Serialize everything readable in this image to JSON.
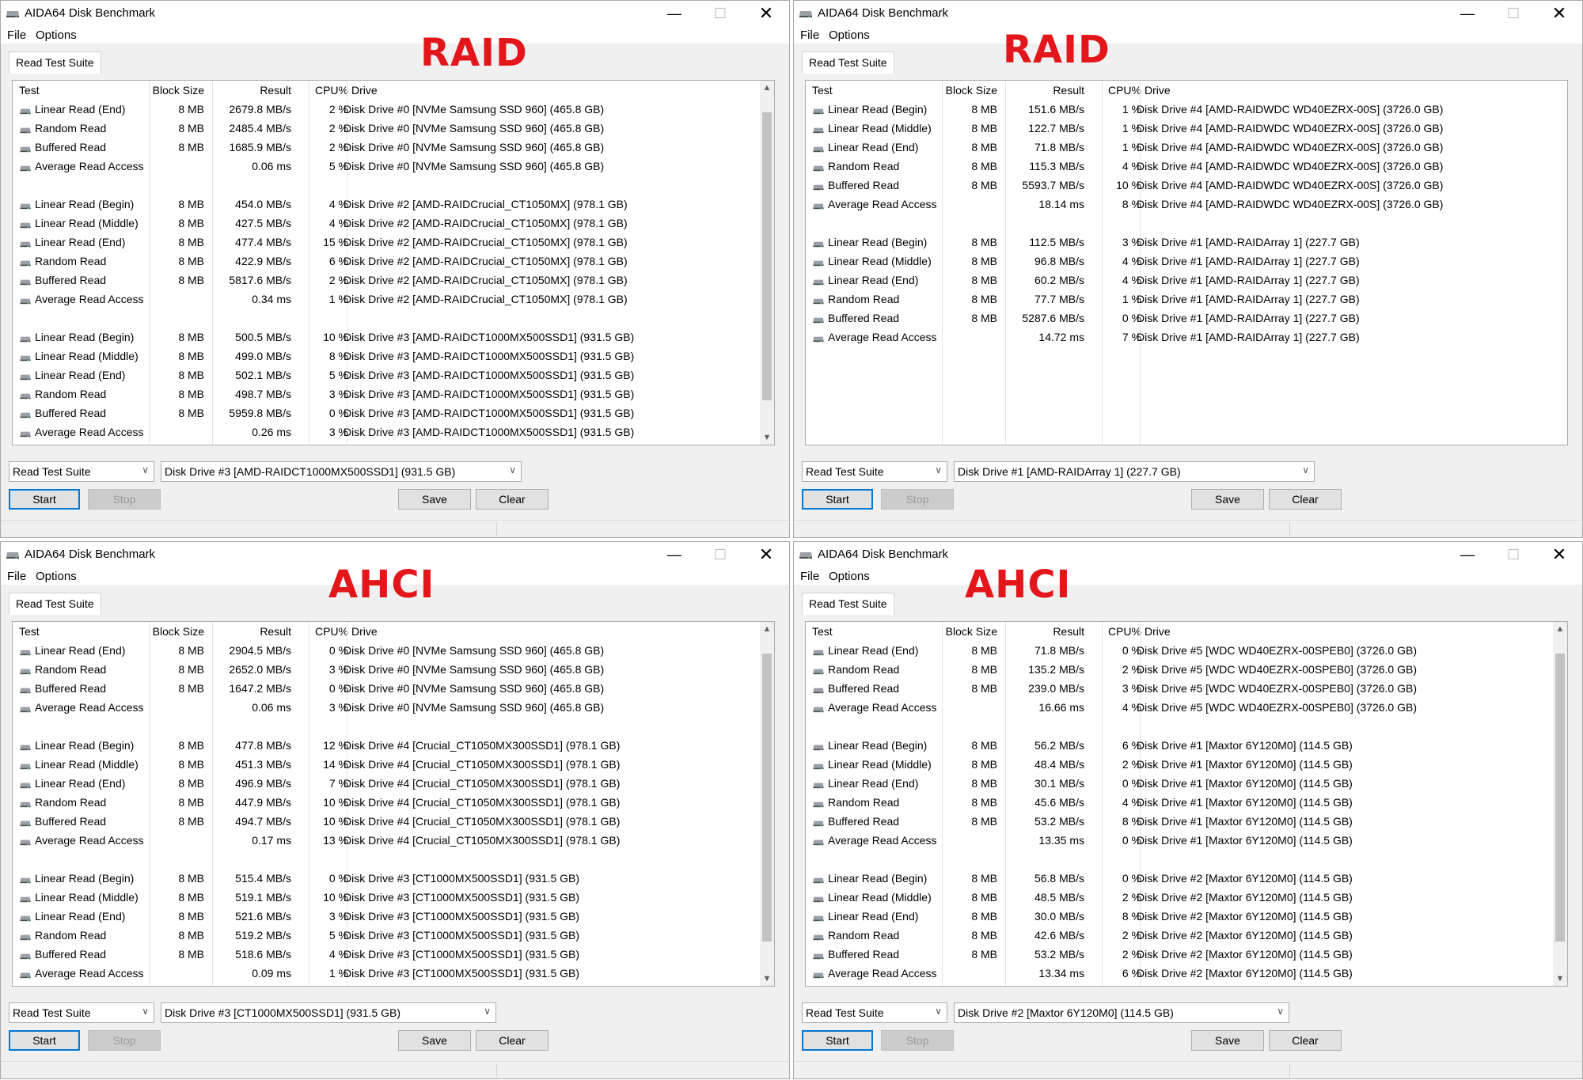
{
  "windows": [
    {
      "title": "AIDA64 Disk Benchmark",
      "menu": [
        "File",
        "Options"
      ],
      "annotation": "RAID",
      "tab": "Read Test Suite",
      "columns": [
        "Test",
        "Block Size",
        "Result",
        "CPU%",
        "Drive"
      ],
      "rows": [
        [
          "Linear Read (End)",
          "8 MB",
          "2679.8 MB/s",
          "2 %",
          "Disk Drive #0  [NVMe    Samsung SSD 960]  (465.8 GB)"
        ],
        [
          "Random Read",
          "8 MB",
          "2485.4 MB/s",
          "2 %",
          "Disk Drive #0  [NVMe    Samsung SSD 960]  (465.8 GB)"
        ],
        [
          "Buffered Read",
          "8 MB",
          "1685.9 MB/s",
          "2 %",
          "Disk Drive #0  [NVMe    Samsung SSD 960]  (465.8 GB)"
        ],
        [
          "Average Read Access",
          "",
          "0.06 ms",
          "5 %",
          "Disk Drive #0  [NVMe    Samsung SSD 960]  (465.8 GB)"
        ],
        null,
        [
          "Linear Read (Begin)",
          "8 MB",
          "454.0 MB/s",
          "4 %",
          "Disk Drive #2  [AMD-RAIDCrucial_CT1050MX]  (978.1 GB)"
        ],
        [
          "Linear Read (Middle)",
          "8 MB",
          "427.5 MB/s",
          "4 %",
          "Disk Drive #2  [AMD-RAIDCrucial_CT1050MX]  (978.1 GB)"
        ],
        [
          "Linear Read (End)",
          "8 MB",
          "477.4 MB/s",
          "15 %",
          "Disk Drive #2  [AMD-RAIDCrucial_CT1050MX]  (978.1 GB)"
        ],
        [
          "Random Read",
          "8 MB",
          "422.9 MB/s",
          "6 %",
          "Disk Drive #2  [AMD-RAIDCrucial_CT1050MX]  (978.1 GB)"
        ],
        [
          "Buffered Read",
          "8 MB",
          "5817.6 MB/s",
          "2 %",
          "Disk Drive #2  [AMD-RAIDCrucial_CT1050MX]  (978.1 GB)"
        ],
        [
          "Average Read Access",
          "",
          "0.34 ms",
          "1 %",
          "Disk Drive #2  [AMD-RAIDCrucial_CT1050MX]  (978.1 GB)"
        ],
        null,
        [
          "Linear Read (Begin)",
          "8 MB",
          "500.5 MB/s",
          "10 %",
          "Disk Drive #3  [AMD-RAIDCT1000MX500SSD1]  (931.5 GB)"
        ],
        [
          "Linear Read (Middle)",
          "8 MB",
          "499.0 MB/s",
          "8 %",
          "Disk Drive #3  [AMD-RAIDCT1000MX500SSD1]  (931.5 GB)"
        ],
        [
          "Linear Read (End)",
          "8 MB",
          "502.1 MB/s",
          "5 %",
          "Disk Drive #3  [AMD-RAIDCT1000MX500SSD1]  (931.5 GB)"
        ],
        [
          "Random Read",
          "8 MB",
          "498.7 MB/s",
          "3 %",
          "Disk Drive #3  [AMD-RAIDCT1000MX500SSD1]  (931.5 GB)"
        ],
        [
          "Buffered Read",
          "8 MB",
          "5959.8 MB/s",
          "0 %",
          "Disk Drive #3  [AMD-RAIDCT1000MX500SSD1]  (931.5 GB)"
        ],
        [
          "Average Read Access",
          "",
          "0.26 ms",
          "3 %",
          "Disk Drive #3  [AMD-RAIDCT1000MX500SSD1]  (931.5 GB)"
        ]
      ],
      "has_scrollbar": true,
      "suite_select": "Read Test Suite",
      "drive_select": "Disk Drive #3  [AMD-RAIDCT1000MX500SSD1]  (931.5 GB)",
      "buttons": {
        "start": "Start",
        "stop": "Stop",
        "save": "Save",
        "clear": "Clear"
      }
    },
    {
      "title": "AIDA64 Disk Benchmark",
      "menu": [
        "File",
        "Options"
      ],
      "annotation": "RAID",
      "tab": "Read Test Suite",
      "columns": [
        "Test",
        "Block Size",
        "Result",
        "CPU%",
        "Drive"
      ],
      "rows": [
        [
          "Linear Read (Begin)",
          "8 MB",
          "151.6 MB/s",
          "1 %",
          "Disk Drive #4  [AMD-RAIDWDC WD40EZRX-00S]  (3726.0 GB)"
        ],
        [
          "Linear Read (Middle)",
          "8 MB",
          "122.7 MB/s",
          "1 %",
          "Disk Drive #4  [AMD-RAIDWDC WD40EZRX-00S]  (3726.0 GB)"
        ],
        [
          "Linear Read (End)",
          "8 MB",
          "71.8 MB/s",
          "1 %",
          "Disk Drive #4  [AMD-RAIDWDC WD40EZRX-00S]  (3726.0 GB)"
        ],
        [
          "Random Read",
          "8 MB",
          "115.3 MB/s",
          "4 %",
          "Disk Drive #4  [AMD-RAIDWDC WD40EZRX-00S]  (3726.0 GB)"
        ],
        [
          "Buffered Read",
          "8 MB",
          "5593.7 MB/s",
          "10 %",
          "Disk Drive #4  [AMD-RAIDWDC WD40EZRX-00S]  (3726.0 GB)"
        ],
        [
          "Average Read Access",
          "",
          "18.14 ms",
          "8 %",
          "Disk Drive #4  [AMD-RAIDWDC WD40EZRX-00S]  (3726.0 GB)"
        ],
        null,
        [
          "Linear Read (Begin)",
          "8 MB",
          "112.5 MB/s",
          "3 %",
          "Disk Drive #1  [AMD-RAIDArray 1]  (227.7 GB)"
        ],
        [
          "Linear Read (Middle)",
          "8 MB",
          "96.8 MB/s",
          "4 %",
          "Disk Drive #1  [AMD-RAIDArray 1]  (227.7 GB)"
        ],
        [
          "Linear Read (End)",
          "8 MB",
          "60.2 MB/s",
          "4 %",
          "Disk Drive #1  [AMD-RAIDArray 1]  (227.7 GB)"
        ],
        [
          "Random Read",
          "8 MB",
          "77.7 MB/s",
          "1 %",
          "Disk Drive #1  [AMD-RAIDArray 1]  (227.7 GB)"
        ],
        [
          "Buffered Read",
          "8 MB",
          "5287.6 MB/s",
          "0 %",
          "Disk Drive #1  [AMD-RAIDArray 1]  (227.7 GB)"
        ],
        [
          "Average Read Access",
          "",
          "14.72 ms",
          "7 %",
          "Disk Drive #1  [AMD-RAIDArray 1]  (227.7 GB)"
        ]
      ],
      "has_scrollbar": false,
      "suite_select": "Read Test Suite",
      "drive_select": "Disk Drive #1  [AMD-RAIDArray 1]  (227.7 GB)",
      "buttons": {
        "start": "Start",
        "stop": "Stop",
        "save": "Save",
        "clear": "Clear"
      }
    },
    {
      "title": "AIDA64 Disk Benchmark",
      "menu": [
        "File",
        "Options"
      ],
      "annotation": "AHCI",
      "tab": "Read Test Suite",
      "columns": [
        "Test",
        "Block Size",
        "Result",
        "CPU%",
        "Drive"
      ],
      "rows": [
        [
          "Linear Read (End)",
          "8 MB",
          "2904.5 MB/s",
          "0 %",
          "Disk Drive #0  [NVMe    Samsung SSD 960]  (465.8 GB)"
        ],
        [
          "Random Read",
          "8 MB",
          "2652.0 MB/s",
          "3 %",
          "Disk Drive #0  [NVMe    Samsung SSD 960]  (465.8 GB)"
        ],
        [
          "Buffered Read",
          "8 MB",
          "1647.2 MB/s",
          "0 %",
          "Disk Drive #0  [NVMe    Samsung SSD 960]  (465.8 GB)"
        ],
        [
          "Average Read Access",
          "",
          "0.06 ms",
          "3 %",
          "Disk Drive #0  [NVMe    Samsung SSD 960]  (465.8 GB)"
        ],
        null,
        [
          "Linear Read (Begin)",
          "8 MB",
          "477.8 MB/s",
          "12 %",
          "Disk Drive #4  [Crucial_CT1050MX300SSD1]  (978.1 GB)"
        ],
        [
          "Linear Read (Middle)",
          "8 MB",
          "451.3 MB/s",
          "14 %",
          "Disk Drive #4  [Crucial_CT1050MX300SSD1]  (978.1 GB)"
        ],
        [
          "Linear Read (End)",
          "8 MB",
          "496.9 MB/s",
          "7 %",
          "Disk Drive #4  [Crucial_CT1050MX300SSD1]  (978.1 GB)"
        ],
        [
          "Random Read",
          "8 MB",
          "447.9 MB/s",
          "10 %",
          "Disk Drive #4  [Crucial_CT1050MX300SSD1]  (978.1 GB)"
        ],
        [
          "Buffered Read",
          "8 MB",
          "494.7 MB/s",
          "10 %",
          "Disk Drive #4  [Crucial_CT1050MX300SSD1]  (978.1 GB)"
        ],
        [
          "Average Read Access",
          "",
          "0.17 ms",
          "13 %",
          "Disk Drive #4  [Crucial_CT1050MX300SSD1]  (978.1 GB)"
        ],
        null,
        [
          "Linear Read (Begin)",
          "8 MB",
          "515.4 MB/s",
          "0 %",
          "Disk Drive #3  [CT1000MX500SSD1]  (931.5 GB)"
        ],
        [
          "Linear Read (Middle)",
          "8 MB",
          "519.1 MB/s",
          "10 %",
          "Disk Drive #3  [CT1000MX500SSD1]  (931.5 GB)"
        ],
        [
          "Linear Read (End)",
          "8 MB",
          "521.6 MB/s",
          "3 %",
          "Disk Drive #3  [CT1000MX500SSD1]  (931.5 GB)"
        ],
        [
          "Random Read",
          "8 MB",
          "519.2 MB/s",
          "5 %",
          "Disk Drive #3  [CT1000MX500SSD1]  (931.5 GB)"
        ],
        [
          "Buffered Read",
          "8 MB",
          "518.6 MB/s",
          "4 %",
          "Disk Drive #3  [CT1000MX500SSD1]  (931.5 GB)"
        ],
        [
          "Average Read Access",
          "",
          "0.09 ms",
          "1 %",
          "Disk Drive #3  [CT1000MX500SSD1]  (931.5 GB)"
        ]
      ],
      "has_scrollbar": true,
      "suite_select": "Read Test Suite",
      "drive_select": "Disk Drive #3  [CT1000MX500SSD1]  (931.5 GB)",
      "buttons": {
        "start": "Start",
        "stop": "Stop",
        "save": "Save",
        "clear": "Clear"
      }
    },
    {
      "title": "AIDA64 Disk Benchmark",
      "menu": [
        "File",
        "Options"
      ],
      "annotation": "AHCI",
      "tab": "Read Test Suite",
      "columns": [
        "Test",
        "Block Size",
        "Result",
        "CPU%",
        "Drive"
      ],
      "rows": [
        [
          "Linear Read (End)",
          "8 MB",
          "71.8 MB/s",
          "0 %",
          "Disk Drive #5  [WDC WD40EZRX-00SPEB0]  (3726.0 GB)"
        ],
        [
          "Random Read",
          "8 MB",
          "135.2 MB/s",
          "2 %",
          "Disk Drive #5  [WDC WD40EZRX-00SPEB0]  (3726.0 GB)"
        ],
        [
          "Buffered Read",
          "8 MB",
          "239.0 MB/s",
          "3 %",
          "Disk Drive #5  [WDC WD40EZRX-00SPEB0]  (3726.0 GB)"
        ],
        [
          "Average Read Access",
          "",
          "16.66 ms",
          "4 %",
          "Disk Drive #5  [WDC WD40EZRX-00SPEB0]  (3726.0 GB)"
        ],
        null,
        [
          "Linear Read (Begin)",
          "8 MB",
          "56.2 MB/s",
          "6 %",
          "Disk Drive #1  [Maxtor 6Y120M0]  (114.5 GB)"
        ],
        [
          "Linear Read (Middle)",
          "8 MB",
          "48.4 MB/s",
          "2 %",
          "Disk Drive #1  [Maxtor 6Y120M0]  (114.5 GB)"
        ],
        [
          "Linear Read (End)",
          "8 MB",
          "30.1 MB/s",
          "0 %",
          "Disk Drive #1  [Maxtor 6Y120M0]  (114.5 GB)"
        ],
        [
          "Random Read",
          "8 MB",
          "45.6 MB/s",
          "4 %",
          "Disk Drive #1  [Maxtor 6Y120M0]  (114.5 GB)"
        ],
        [
          "Buffered Read",
          "8 MB",
          "53.2 MB/s",
          "8 %",
          "Disk Drive #1  [Maxtor 6Y120M0]  (114.5 GB)"
        ],
        [
          "Average Read Access",
          "",
          "13.35 ms",
          "0 %",
          "Disk Drive #1  [Maxtor 6Y120M0]  (114.5 GB)"
        ],
        null,
        [
          "Linear Read (Begin)",
          "8 MB",
          "56.8 MB/s",
          "0 %",
          "Disk Drive #2  [Maxtor 6Y120M0]  (114.5 GB)"
        ],
        [
          "Linear Read (Middle)",
          "8 MB",
          "48.5 MB/s",
          "2 %",
          "Disk Drive #2  [Maxtor 6Y120M0]  (114.5 GB)"
        ],
        [
          "Linear Read (End)",
          "8 MB",
          "30.0 MB/s",
          "8 %",
          "Disk Drive #2  [Maxtor 6Y120M0]  (114.5 GB)"
        ],
        [
          "Random Read",
          "8 MB",
          "42.6 MB/s",
          "2 %",
          "Disk Drive #2  [Maxtor 6Y120M0]  (114.5 GB)"
        ],
        [
          "Buffered Read",
          "8 MB",
          "53.2 MB/s",
          "2 %",
          "Disk Drive #2  [Maxtor 6Y120M0]  (114.5 GB)"
        ],
        [
          "Average Read Access",
          "",
          "13.34 ms",
          "6 %",
          "Disk Drive #2  [Maxtor 6Y120M0]  (114.5 GB)"
        ]
      ],
      "has_scrollbar": true,
      "suite_select": "Read Test Suite",
      "drive_select": "Disk Drive #2  [Maxtor 6Y120M0]  (114.5 GB)",
      "buttons": {
        "start": "Start",
        "stop": "Stop",
        "save": "Save",
        "clear": "Clear"
      }
    }
  ],
  "colors": {
    "annotation": "#e3161b",
    "focus_border": "#0078d7",
    "window_bg": "#f0f0f0"
  },
  "icons": {
    "app": "disk-icon",
    "row": "disk-icon"
  }
}
